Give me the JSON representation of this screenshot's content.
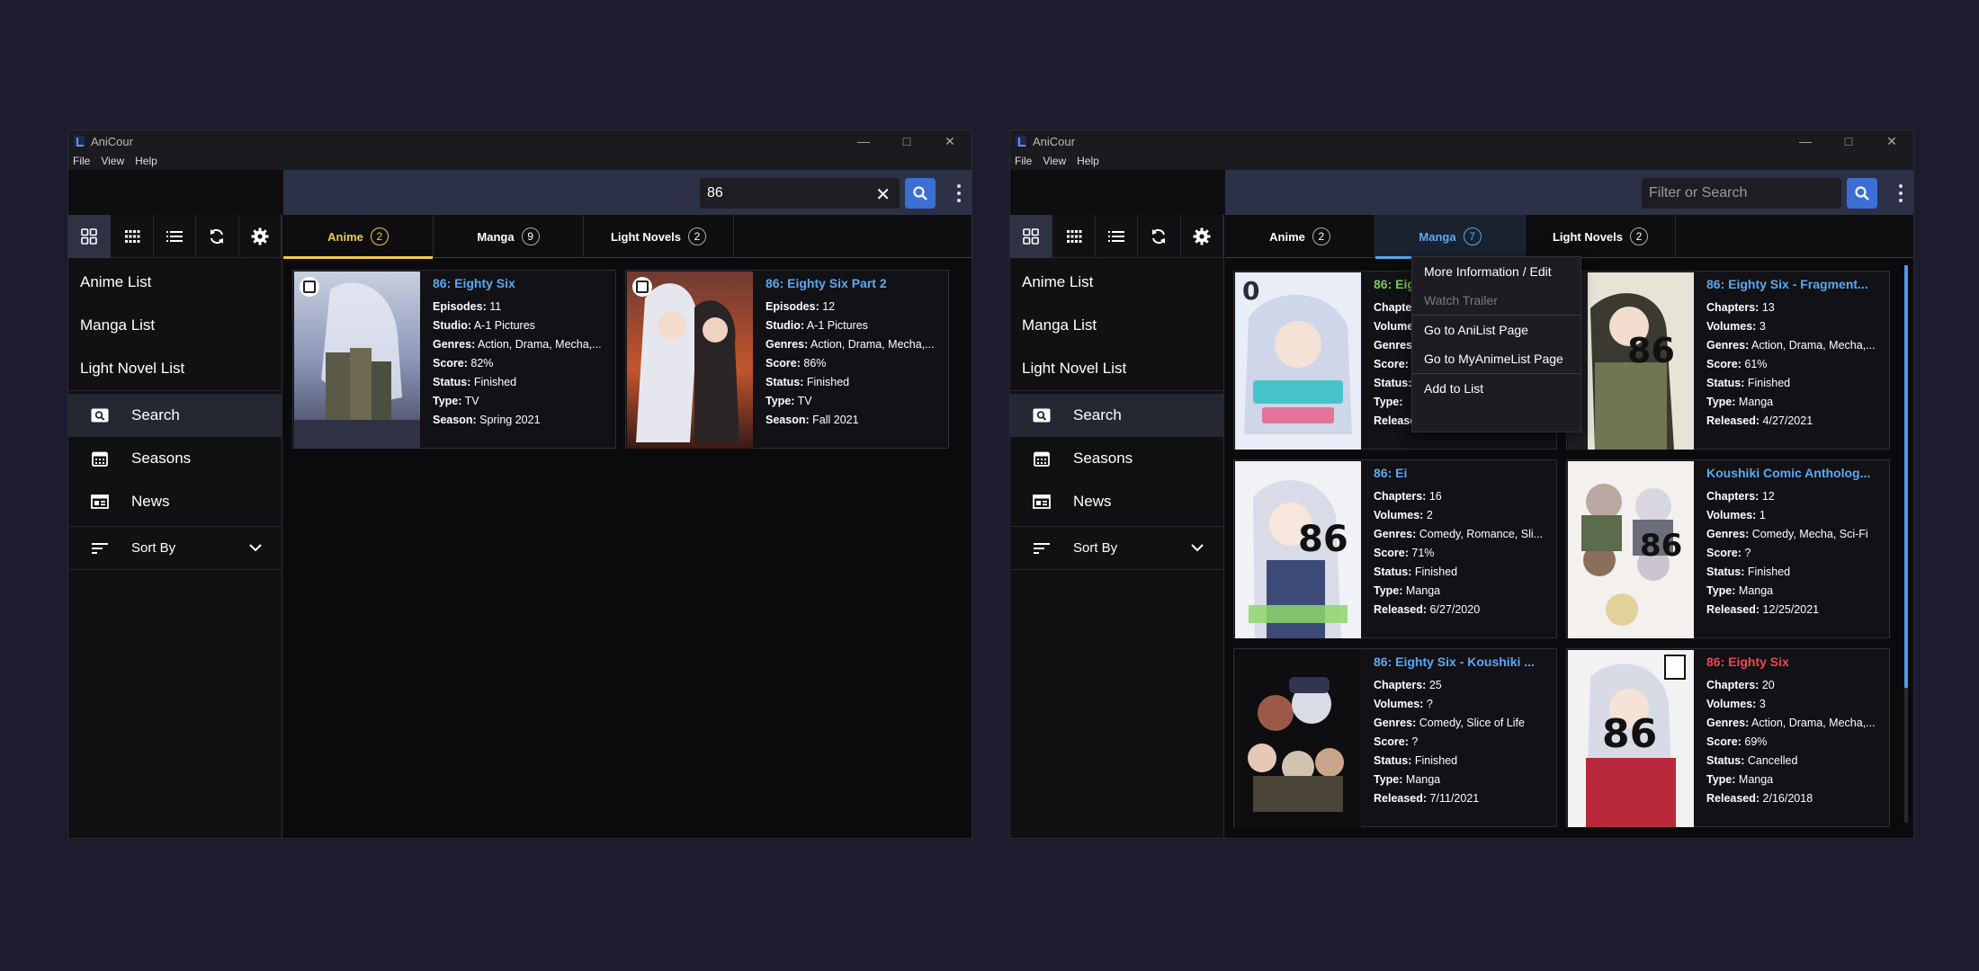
{
  "window1": {
    "app_title": "AniCour",
    "menu": [
      "File",
      "View",
      "Help"
    ],
    "search": {
      "value": "86",
      "placeholder": "Filter or Search"
    },
    "sidebar": {
      "lists": [
        "Anime List",
        "Manga List",
        "Light Novel List"
      ],
      "nav": [
        {
          "label": "Search",
          "icon": "search-icon",
          "selected": true
        },
        {
          "label": "Seasons",
          "icon": "calendar-icon",
          "selected": false
        },
        {
          "label": "News",
          "icon": "news-icon",
          "selected": false
        }
      ],
      "sort_label": "Sort By"
    },
    "tabs": [
      {
        "label": "Anime",
        "count": "2",
        "selected": true
      },
      {
        "label": "Manga",
        "count": "9",
        "selected": false
      },
      {
        "label": "Light Novels",
        "count": "2",
        "selected": false
      }
    ],
    "cards": [
      {
        "title": "86: Eighty Six",
        "rows": [
          {
            "k": "Episodes:",
            "v": "11"
          },
          {
            "k": "Studio:",
            "v": "A-1 Pictures"
          },
          {
            "k": "Genres:",
            "v": "Action, Drama, Mecha,..."
          },
          {
            "k": "Score:",
            "v": "82%"
          },
          {
            "k": "Status:",
            "v": "Finished"
          },
          {
            "k": "Type:",
            "v": "TV"
          },
          {
            "k": "Season:",
            "v": "Spring 2021"
          }
        ]
      },
      {
        "title": "86: Eighty Six Part 2",
        "rows": [
          {
            "k": "Episodes:",
            "v": "12"
          },
          {
            "k": "Studio:",
            "v": "A-1 Pictures"
          },
          {
            "k": "Genres:",
            "v": "Action, Drama, Mecha,..."
          },
          {
            "k": "Score:",
            "v": "86%"
          },
          {
            "k": "Status:",
            "v": "Finished"
          },
          {
            "k": "Type:",
            "v": "TV"
          },
          {
            "k": "Season:",
            "v": "Fall 2021"
          }
        ]
      }
    ]
  },
  "window2": {
    "app_title": "AniCour",
    "menu": [
      "File",
      "View",
      "Help"
    ],
    "search": {
      "value": "",
      "placeholder": "Filter or Search"
    },
    "sidebar": {
      "lists": [
        "Anime List",
        "Manga List",
        "Light Novel List"
      ],
      "nav": [
        {
          "label": "Search",
          "icon": "search-icon",
          "selected": true
        },
        {
          "label": "Seasons",
          "icon": "calendar-icon",
          "selected": false
        },
        {
          "label": "News",
          "icon": "news-icon",
          "selected": false
        }
      ],
      "sort_label": "Sort By"
    },
    "tabs": [
      {
        "label": "Anime",
        "count": "2",
        "selected": false
      },
      {
        "label": "Manga",
        "count": "7",
        "selected": true
      },
      {
        "label": "Light Novels",
        "count": "2",
        "selected": false
      }
    ],
    "cards": [
      {
        "title": "86: Eighty Six - Mahou Sh...",
        "color": "green",
        "rows": [
          {
            "k": "Chapters:",
            "v": "?"
          },
          {
            "k": "Volumes:",
            "v": "?"
          },
          {
            "k": "Genres:",
            "v": ""
          },
          {
            "k": "Score:",
            "v": ""
          },
          {
            "k": "Status:",
            "v": ""
          },
          {
            "k": "Type:",
            "v": ""
          },
          {
            "k": "Released:",
            "v": ""
          }
        ]
      },
      {
        "title": "86: Eighty Six - Fragment...",
        "color": "blue",
        "rows": [
          {
            "k": "Chapters:",
            "v": "13"
          },
          {
            "k": "Volumes:",
            "v": "3"
          },
          {
            "k": "Genres:",
            "v": "Action, Drama, Mecha,..."
          },
          {
            "k": "Score:",
            "v": "61%"
          },
          {
            "k": "Status:",
            "v": "Finished"
          },
          {
            "k": "Type:",
            "v": "Manga"
          },
          {
            "k": "Released:",
            "v": "4/27/2021"
          }
        ]
      },
      {
        "title": "86: Ei",
        "color": "blue",
        "rows": [
          {
            "k": "Chapters:",
            "v": "16"
          },
          {
            "k": "Volumes:",
            "v": "2"
          },
          {
            "k": "Genres:",
            "v": "Comedy, Romance, Sli..."
          },
          {
            "k": "Score:",
            "v": "71%"
          },
          {
            "k": "Status:",
            "v": "Finished"
          },
          {
            "k": "Type:",
            "v": "Manga"
          },
          {
            "k": "Released:",
            "v": "6/27/2020"
          }
        ]
      },
      {
        "title": "Koushiki Comic Antholog...",
        "color": "blue",
        "rows": [
          {
            "k": "Chapters:",
            "v": "12"
          },
          {
            "k": "Volumes:",
            "v": "1"
          },
          {
            "k": "Genres:",
            "v": "Comedy, Mecha, Sci-Fi"
          },
          {
            "k": "Score:",
            "v": "?"
          },
          {
            "k": "Status:",
            "v": "Finished"
          },
          {
            "k": "Type:",
            "v": "Manga"
          },
          {
            "k": "Released:",
            "v": "12/25/2021"
          }
        ]
      },
      {
        "title": "86: Eighty Six - Koushiki ...",
        "color": "blue",
        "rows": [
          {
            "k": "Chapters:",
            "v": "25"
          },
          {
            "k": "Volumes:",
            "v": "?"
          },
          {
            "k": "Genres:",
            "v": "Comedy, Slice of Life"
          },
          {
            "k": "Score:",
            "v": "?"
          },
          {
            "k": "Status:",
            "v": "Finished"
          },
          {
            "k": "Type:",
            "v": "Manga"
          },
          {
            "k": "Released:",
            "v": "7/11/2021"
          }
        ]
      },
      {
        "title": "86: Eighty Six",
        "color": "red",
        "rows": [
          {
            "k": "Chapters:",
            "v": "20"
          },
          {
            "k": "Volumes:",
            "v": "3"
          },
          {
            "k": "Genres:",
            "v": "Action, Drama, Mecha,..."
          },
          {
            "k": "Score:",
            "v": "69%"
          },
          {
            "k": "Status:",
            "v": "Cancelled"
          },
          {
            "k": "Type:",
            "v": "Manga"
          },
          {
            "k": "Released:",
            "v": "2/16/2018"
          }
        ]
      }
    ],
    "context_menu": [
      {
        "label": "More Information / Edit",
        "enabled": true
      },
      {
        "label": "Watch Trailer",
        "enabled": false
      },
      {
        "label": "Go to AniList Page",
        "enabled": true
      },
      {
        "label": "Go to MyAnimeList Page",
        "enabled": true
      },
      {
        "label": "Add to List",
        "enabled": true
      }
    ]
  },
  "colors": {
    "background": "#1c1c2e",
    "accent_blue": "#3b6fd6",
    "title_blue": "#5aa9f0",
    "anime_tab_yellow": "#f2c94c",
    "green_title": "#7ac95b",
    "red_title": "#e84a4a"
  }
}
